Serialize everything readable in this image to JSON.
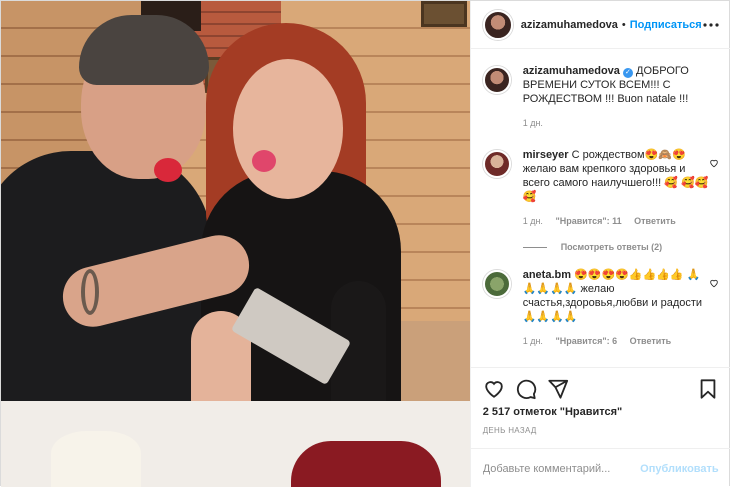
{
  "post": {
    "author": "azizamuhamedova",
    "follow_label": "Подписаться",
    "more_icon": "more-icon",
    "caption": {
      "text": "ДОБРОГО ВРЕМЕНИ СУТОК ВСЕМ!!! С РОЖДЕСТВОМ !!! Buon natale !!!",
      "time": "1 дн."
    }
  },
  "comments": [
    {
      "user": "mirseyer",
      "text": "С рождеством😍🙈😍 желаю вам крепкого здоровья и всего самого наилучшего!!! 🥰 🥰🥰🥰",
      "time": "1 дн.",
      "likes": "\"Нравится\": 11",
      "reply": "Ответить",
      "view_replies": "Посмотреть ответы (2)"
    },
    {
      "user": "aneta.bm",
      "text": "😍😍😍😍👍👍👍👍 🙏🙏🙏🙏🙏 желаю счастья,здоровья,любви и радости🙏🙏🙏🙏",
      "time": "1 дн.",
      "likes": "\"Нравится\": 6",
      "reply": "Ответить"
    }
  ],
  "actions": {
    "likes_count": "2 517 отметок \"Нравится\"",
    "date": "ДЕНЬ НАЗАД",
    "comment_placeholder": "Добавьте комментарий...",
    "publish_label": "Опубликовать"
  },
  "colors": {
    "accent": "#0095f6",
    "publish_disabled": "#b2dffc",
    "muted": "#8e8e8e"
  }
}
